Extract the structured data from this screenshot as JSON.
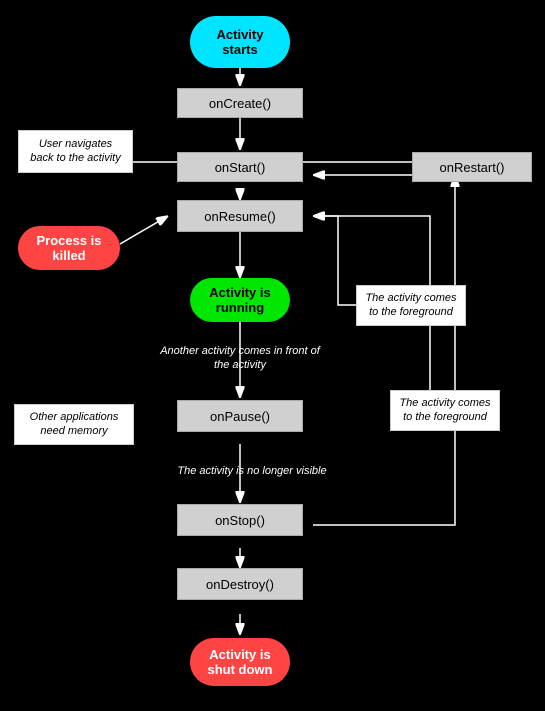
{
  "nodes": {
    "activity_starts": "Activity\nstarts",
    "onCreate": "onCreate()",
    "onStart": "onStart()",
    "onRestart": "onRestart()",
    "onResume": "onResume()",
    "activity_running": "Activity is\nrunning",
    "onPause": "onPause()",
    "onStop": "onStop()",
    "onDestroy": "onDestroy()",
    "activity_shutdown": "Activity is\nshut down"
  },
  "labels": {
    "user_navigates": "User navigates\nback to the\nactivity",
    "process_killed": "Process is\nkilled",
    "another_activity": "Another activity comes\nin front of the activity",
    "other_applications": "Other applications\nneed memory",
    "no_longer_visible": "The activity is no longer visible",
    "comes_foreground1": "The activity\ncomes to the\nforeground",
    "comes_foreground2": "The activity\ncomes to the\nforeground"
  }
}
